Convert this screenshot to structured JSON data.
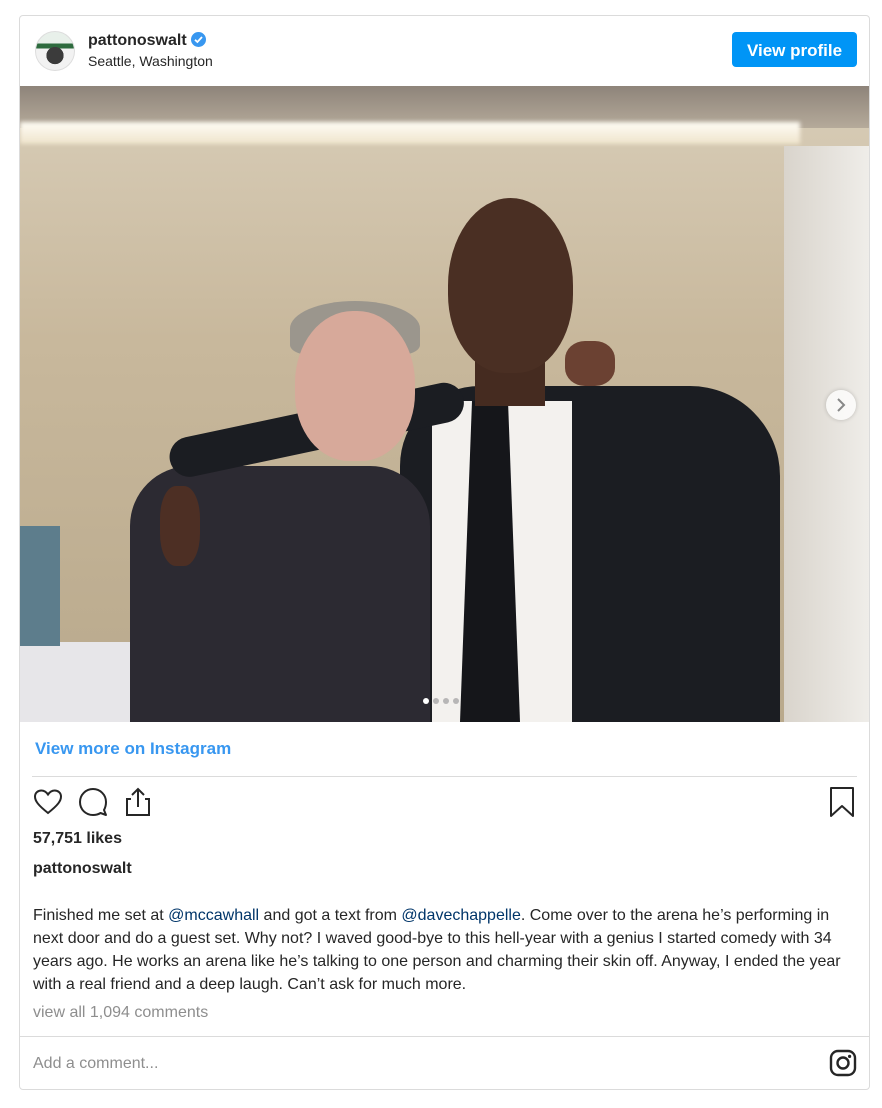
{
  "header": {
    "username": "pattonoswalt",
    "location": "Seattle, Washington",
    "view_profile_label": "View profile"
  },
  "photo": {
    "carousel_total": 4,
    "carousel_active": 1
  },
  "footer": {
    "view_more_label": "View more on Instagram",
    "likes": "57,751 likes",
    "author": "pattonoswalt",
    "caption": {
      "part1": "Finished me set at ",
      "mention1": "@mccawhall",
      "part2": " and got a text from ",
      "mention2": "@davechappelle",
      "part3": ". Come over to the arena he’s performing in next door and do a guest set. Why not? I waved good-bye to this hell-year with a genius I started comedy with 34 years ago. He works an arena like he’s talking to one person and charming their skin off. Anyway, I ended the year with a real friend and a deep laugh. Can’t ask for much more."
    },
    "comments_label": "view all 1,094 comments",
    "add_comment_placeholder": "Add a comment..."
  },
  "colors": {
    "accent": "#0095f6",
    "link": "#3897f0",
    "mention": "#003569",
    "muted": "#8e8e8e"
  },
  "icons": [
    "verified-badge-icon",
    "chevron-right-icon",
    "heart-icon",
    "comment-icon",
    "share-icon",
    "bookmark-icon",
    "instagram-icon"
  ]
}
